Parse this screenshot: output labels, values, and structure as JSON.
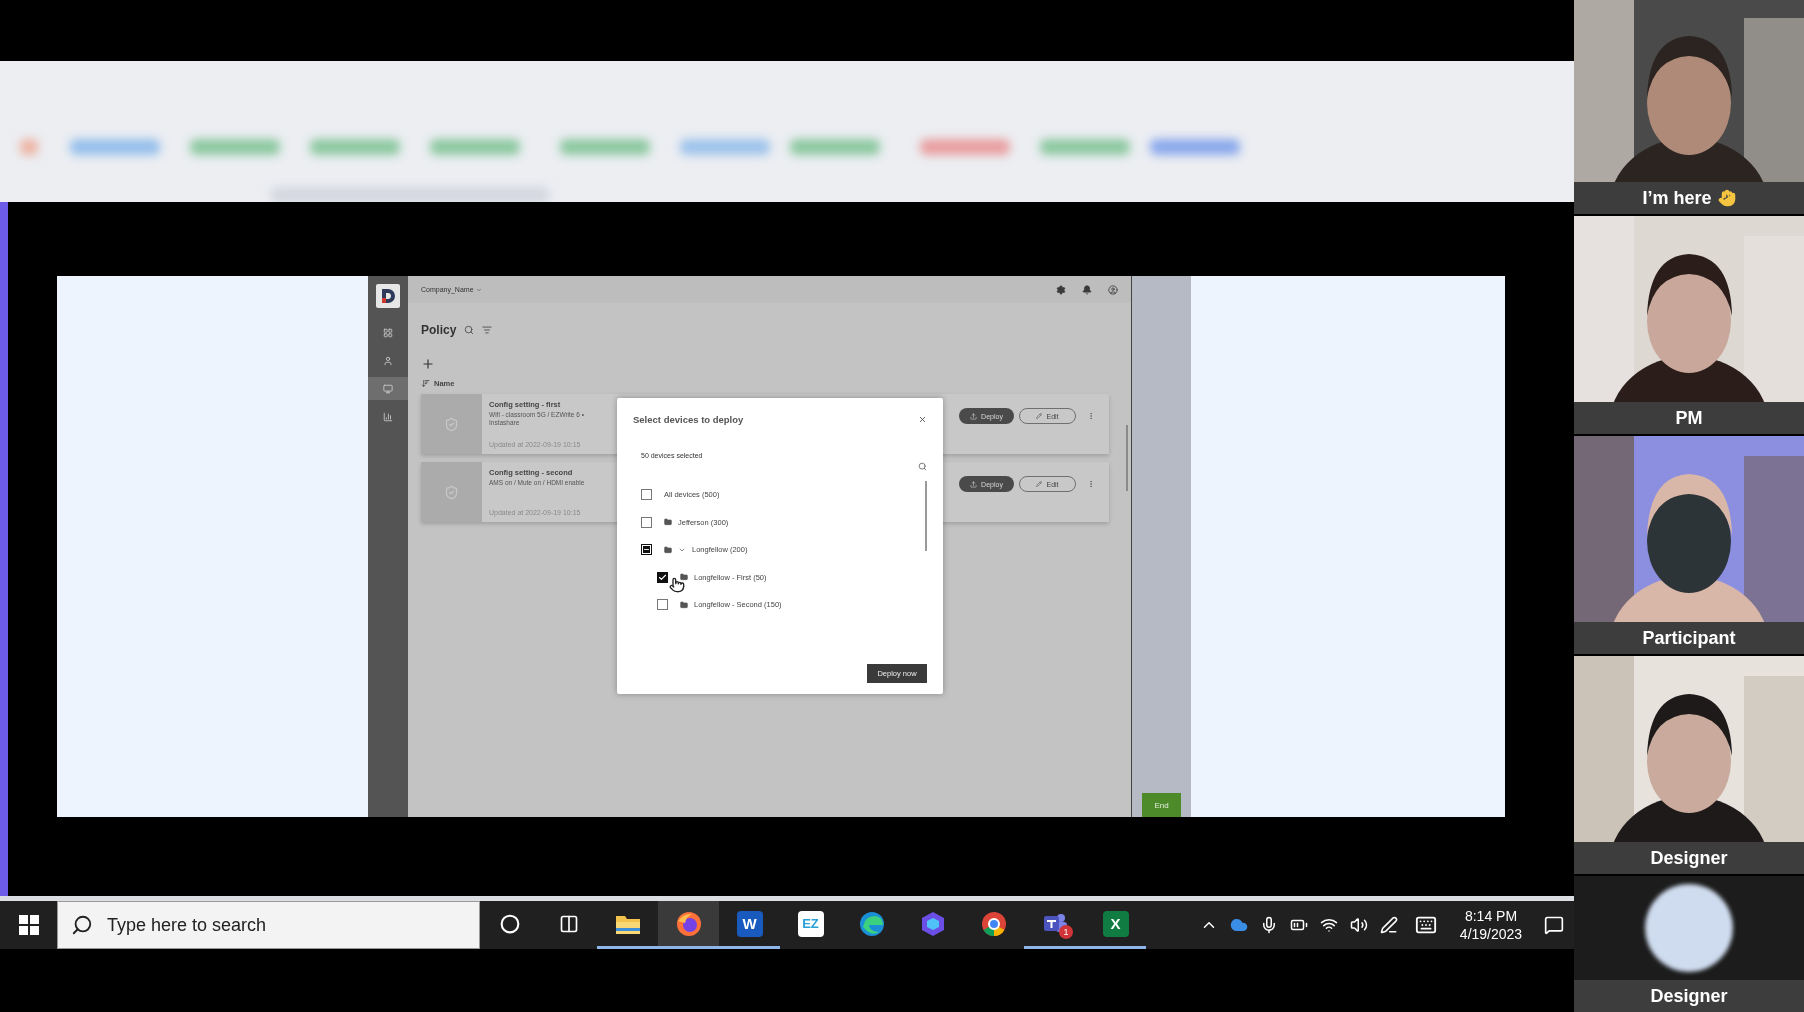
{
  "shared_screen": {
    "app": {
      "header": {
        "company": "Company_Name"
      },
      "sidebar": [
        {
          "kind": "dashboard",
          "selected": false
        },
        {
          "kind": "users",
          "selected": false
        },
        {
          "kind": "devices",
          "selected": true
        },
        {
          "kind": "reports",
          "selected": false
        }
      ],
      "page_title": "Policy",
      "column_header": "Name",
      "policies": [
        {
          "title": "Config setting - first",
          "settings": "Wifi - classroom 5G  /  EZWrite 6 • Instashare",
          "updated": "Updated at 2022-09-19 10:15",
          "deploy": "Deploy",
          "edit": "Edit"
        },
        {
          "title": "Config setting - second",
          "settings": "AMS on  /  Mute on  /  HDMI enable",
          "updated": "Updated at 2022-09-19 10:15",
          "deploy": "Deploy",
          "edit": "Edit"
        }
      ],
      "end_button": "End"
    },
    "dialog": {
      "title": "Select devices to deploy",
      "selected_count": "50 devices selected",
      "deploy_button": "Deploy now",
      "devices": [
        {
          "label": "All devices (500)",
          "kind": "all",
          "checked": false,
          "indeterminate": false
        },
        {
          "label": "Jefferson (300)",
          "kind": "folder",
          "checked": false,
          "indeterminate": false
        },
        {
          "label": "Longfellow (200)",
          "kind": "folder",
          "checked": false,
          "indeterminate": true,
          "expanded": true,
          "children": [
            {
              "label": "Longfellow - First (50)",
              "kind": "folder",
              "checked": true,
              "indeterminate": false
            },
            {
              "label": "Longfellow - Second (150)",
              "kind": "folder",
              "checked": false,
              "indeterminate": false
            }
          ]
        }
      ]
    }
  },
  "taskbar": {
    "search_placeholder": "Type here to search",
    "apps": [
      {
        "kind": "explorer",
        "running": true,
        "active": false
      },
      {
        "kind": "firefox",
        "running": true,
        "active": true
      },
      {
        "kind": "word",
        "label": "W",
        "running": true,
        "active": false
      },
      {
        "kind": "ez",
        "label": "EZ",
        "running": false,
        "active": false
      },
      {
        "kind": "edge",
        "running": false,
        "active": false
      },
      {
        "kind": "copilot",
        "running": false,
        "active": false
      },
      {
        "kind": "chrome",
        "running": false,
        "active": false
      },
      {
        "kind": "teams",
        "badge": "1",
        "running": true,
        "active": false
      },
      {
        "kind": "excel",
        "label": "X",
        "running": true,
        "active": false
      }
    ],
    "time": "8:14 PM",
    "date": "4/19/2023"
  },
  "participants": [
    {
      "name": "I’m here",
      "kind": "video",
      "waving": true
    },
    {
      "name": "PM",
      "kind": "video",
      "waving": false
    },
    {
      "name": "Participant",
      "kind": "video",
      "waving": false
    },
    {
      "name": "Designer",
      "kind": "video",
      "waving": false
    },
    {
      "name": "Designer",
      "kind": "avatar",
      "waving": false
    }
  ]
}
